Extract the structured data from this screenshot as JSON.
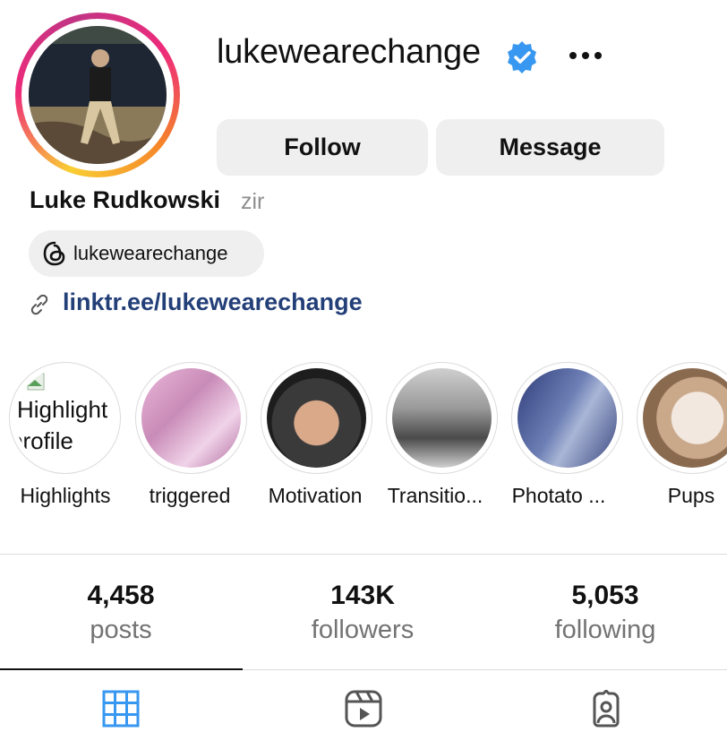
{
  "profile": {
    "username": "lukewearechange",
    "full_name": "Luke Rudkowski",
    "pronouns": "zir",
    "threads_handle": "lukewearechange",
    "link": "linktr.ee/lukewearechange"
  },
  "actions": {
    "follow": "Follow",
    "message": "Message"
  },
  "highlights": [
    {
      "label": "Highlights",
      "broken_alt": "Highlight",
      "broken_alt2": "profile"
    },
    {
      "label": "triggered"
    },
    {
      "label": "Motivation"
    },
    {
      "label": "Transitio..."
    },
    {
      "label": "Photato ..."
    },
    {
      "label": "Pups"
    }
  ],
  "stats": {
    "posts": {
      "value": "4,458",
      "label": "posts"
    },
    "followers": {
      "value": "143K",
      "label": "followers"
    },
    "following": {
      "value": "5,053",
      "label": "following"
    }
  },
  "tabs": {
    "icons": [
      "grid-icon",
      "reels-icon",
      "tagged-icon"
    ],
    "active": "grid-icon"
  },
  "colors": {
    "link": "#233f78",
    "verified": "#3897f0",
    "button_bg": "#efefef",
    "muted": "#737373"
  }
}
